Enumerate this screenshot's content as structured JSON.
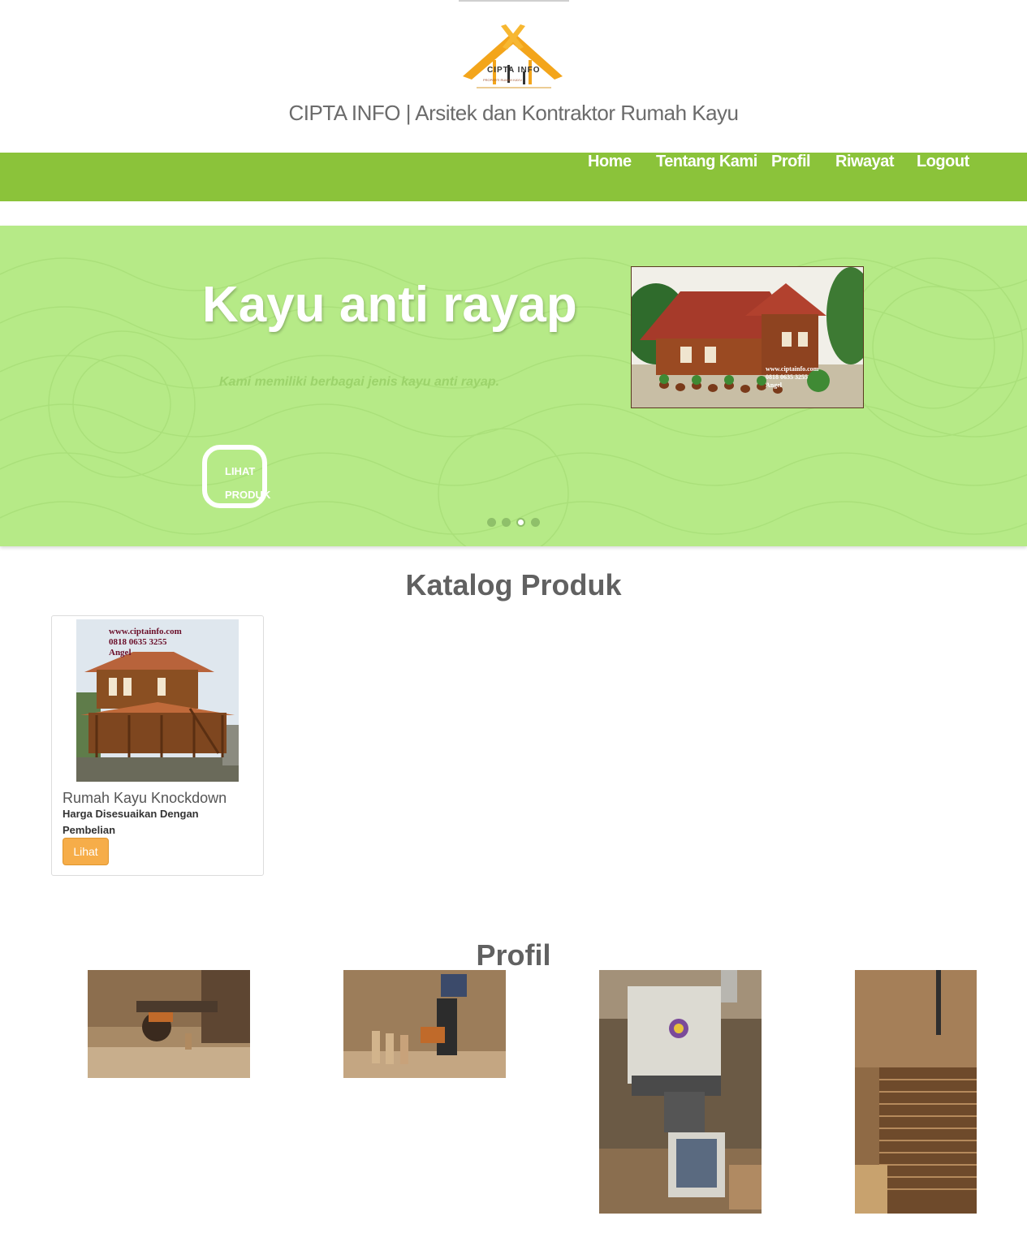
{
  "header": {
    "logo_text": "CIPTA INFO",
    "logo_subtext": "PROPERTI RUMAH KAYU",
    "title": "CIPTA INFO | Arsitek dan Kontraktor Rumah Kayu"
  },
  "nav": {
    "items": [
      {
        "label": "Home"
      },
      {
        "label": "Tentang Kami"
      },
      {
        "label": "Profil"
      },
      {
        "label": "Riwayat"
      },
      {
        "label": "Logout"
      }
    ]
  },
  "slider": {
    "title": "Kayu anti rayap",
    "subtitle": "Kami memiliki berbagai jenis kayu anti rayap.",
    "button_line1": "LIHAT",
    "button_line2": "PRODUK",
    "image_watermark_line1": "www.ciptainfo.com",
    "image_watermark_line2": "0818 0635 3255",
    "image_watermark_line3": "Angel",
    "dot_count": 4,
    "active_dot": 3
  },
  "catalog": {
    "heading": "Katalog Produk",
    "products": [
      {
        "name": "Rumah Kayu Knockdown",
        "price": "Harga Disesuaikan Dengan Pembelian",
        "button": "Lihat",
        "watermark_line1": "www.ciptainfo.com",
        "watermark_line2": "0818 0635 3255",
        "watermark_line3": "Angel"
      }
    ]
  },
  "profil": {
    "heading": "Profil"
  },
  "colors": {
    "nav_green": "#8bc33a",
    "slider_green": "#b6ea87",
    "button_orange": "#f6ad49"
  }
}
